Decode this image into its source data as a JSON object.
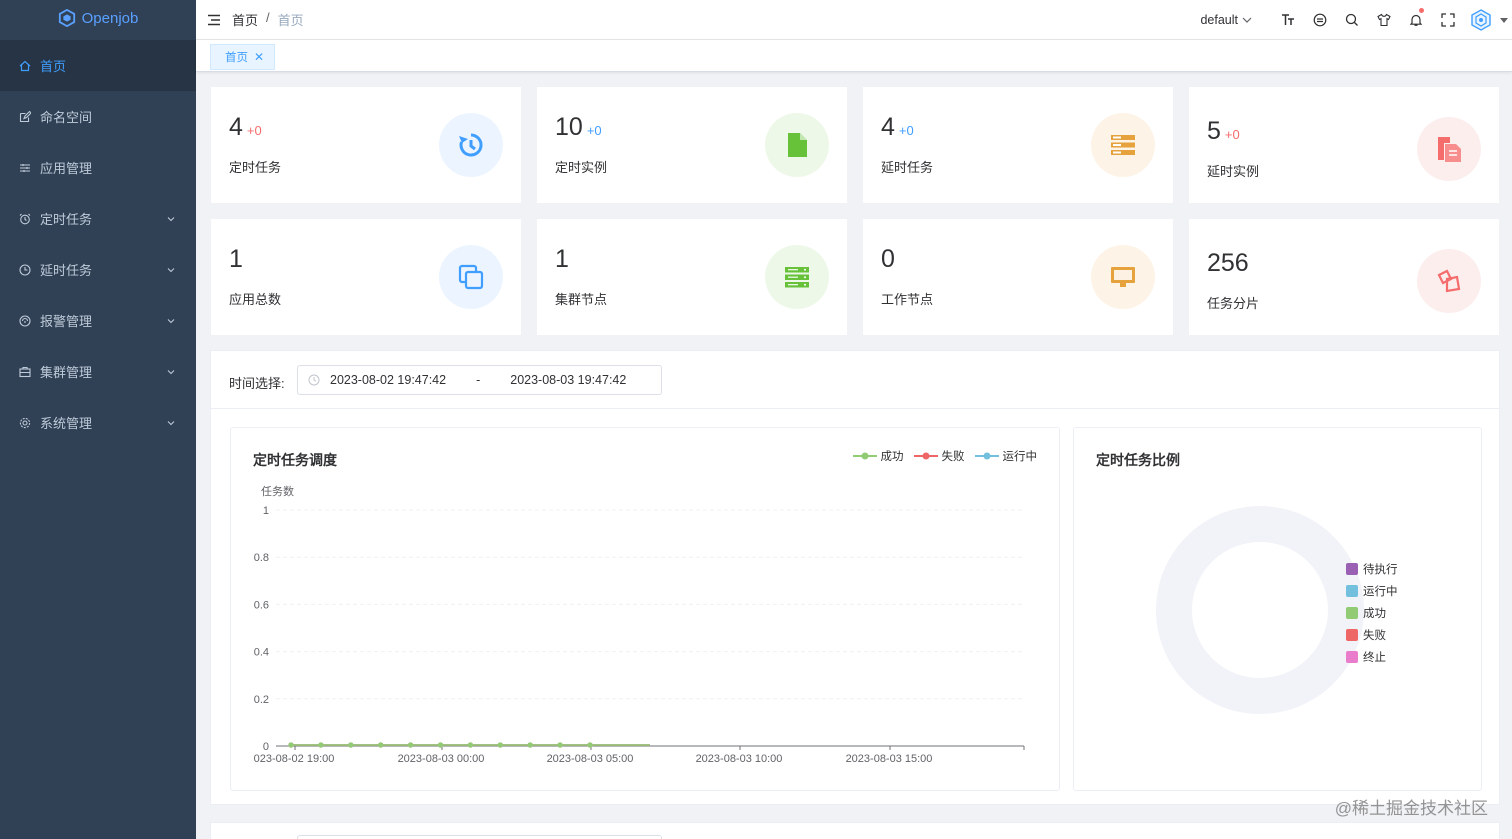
{
  "app": {
    "name": "Openjob"
  },
  "sidebar": {
    "items": [
      {
        "label": "首页",
        "icon": "home-icon",
        "active": true,
        "expandable": false
      },
      {
        "label": "命名空间",
        "icon": "edit-icon",
        "expandable": false
      },
      {
        "label": "应用管理",
        "icon": "sliders-icon",
        "expandable": false
      },
      {
        "label": "定时任务",
        "icon": "alarm-icon",
        "expandable": true
      },
      {
        "label": "延时任务",
        "icon": "clock-icon",
        "expandable": true
      },
      {
        "label": "报警管理",
        "icon": "alert-icon",
        "expandable": true
      },
      {
        "label": "集群管理",
        "icon": "cluster-icon",
        "expandable": true
      },
      {
        "label": "系统管理",
        "icon": "gear-icon",
        "expandable": true
      }
    ]
  },
  "header": {
    "breadcrumb": [
      "首页",
      "首页"
    ],
    "breadcrumb_sep": "/",
    "namespace": "default"
  },
  "tags": [
    {
      "label": "首页",
      "close": "✕"
    }
  ],
  "cards": [
    {
      "value": "4",
      "delta": "+0",
      "label": "定时任务",
      "icon": "history-icon",
      "color": "#409eff",
      "bg": "#ecf5ff",
      "delta_color": "red"
    },
    {
      "value": "10",
      "delta": "+0",
      "label": "定时实例",
      "icon": "document-icon",
      "color": "#67c23a",
      "bg": "#eef8e8",
      "delta_color": "blue"
    },
    {
      "value": "4",
      "delta": "+0",
      "label": "延时任务",
      "icon": "stack-icon",
      "color": "#e6a23c",
      "bg": "#fdf3e6",
      "delta_color": "blue"
    },
    {
      "value": "5",
      "delta": "+0",
      "label": "延时实例",
      "icon": "copy-doc-icon",
      "color": "#f56c6c",
      "bg": "#fdeeee",
      "delta_color": "red"
    },
    {
      "value": "1",
      "delta": "",
      "label": "应用总数",
      "icon": "copy-icon",
      "color": "#409eff",
      "bg": "#ecf5ff"
    },
    {
      "value": "1",
      "delta": "",
      "label": "集群节点",
      "icon": "server-icon",
      "color": "#67c23a",
      "bg": "#eef8e8"
    },
    {
      "value": "0",
      "delta": "",
      "label": "工作节点",
      "icon": "monitor-icon",
      "color": "#e6a23c",
      "bg": "#fdf3e6"
    },
    {
      "value": "256",
      "delta": "",
      "label": "任务分片",
      "icon": "shard-icon",
      "color": "#f56c6c",
      "bg": "#fdeeee"
    }
  ],
  "filter": {
    "label": "时间选择:",
    "start": "2023-08-02 19:47:42",
    "separator": "-",
    "end": "2023-08-03 19:47:42"
  },
  "chart_data": [
    {
      "type": "line",
      "title": "定时任务调度",
      "ylabel": "任务数",
      "xlabel": "",
      "ylim": [
        0,
        1
      ],
      "yticks": [
        "0",
        "0.2",
        "0.4",
        "0.6",
        "0.8",
        "1"
      ],
      "xtick_labels": [
        "023-08-02 19:00",
        "2023-08-03 00:00",
        "2023-08-03 05:00",
        "2023-08-03 10:00",
        "2023-08-03 15:00"
      ],
      "series": [
        {
          "name": "成功",
          "color": "#91cc75",
          "values": [
            0,
            0,
            0,
            0,
            0,
            0,
            0,
            0,
            0,
            0,
            0,
            0,
            0
          ]
        },
        {
          "name": "失败",
          "color": "#ee6666",
          "values": [
            0,
            0,
            0,
            0,
            0,
            0,
            0,
            0,
            0,
            0,
            0,
            0,
            0
          ]
        },
        {
          "name": "运行中",
          "color": "#73c0de",
          "values": [
            0,
            0,
            0,
            0,
            0,
            0,
            0,
            0,
            0,
            0,
            0,
            0,
            0
          ]
        }
      ],
      "legend": "top-right"
    },
    {
      "type": "pie",
      "title": "定时任务比例",
      "legend": "right",
      "series": [
        {
          "name": "待执行",
          "color": "#9a60b4",
          "value": 0
        },
        {
          "name": "运行中",
          "color": "#73c0de",
          "value": 0
        },
        {
          "name": "成功",
          "color": "#91cc75",
          "value": 0
        },
        {
          "name": "失败",
          "color": "#ee6666",
          "value": 0
        },
        {
          "name": "终止",
          "color": "#ea7ccc",
          "value": 0
        }
      ]
    }
  ],
  "watermark": "@稀土掘金技术社区"
}
